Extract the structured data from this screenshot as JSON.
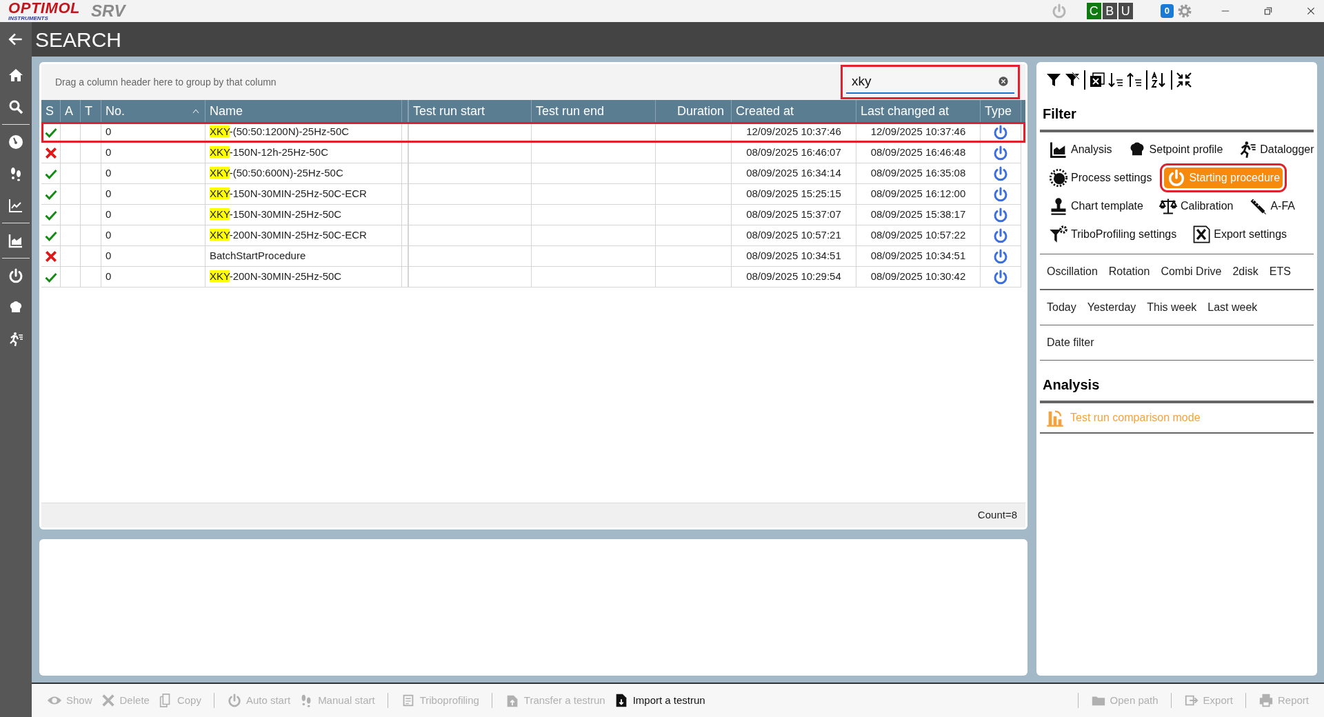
{
  "app_bar": {
    "logo": "OPTIMOL",
    "logo_sub": "INSTRUMENTS",
    "product": "SRV",
    "badges": [
      {
        "label": "C",
        "color": "#0f7a0f"
      },
      {
        "label": "B",
        "color": "#4a4a4a"
      },
      {
        "label": "U",
        "color": "#4a4a4a"
      }
    ],
    "notifications": "0"
  },
  "page": {
    "title": "SEARCH"
  },
  "grid": {
    "group_hint": "Drag a column header here to group by that column",
    "search": {
      "value": "xky",
      "marked": true
    },
    "columns": [
      "S",
      "A",
      "T",
      "No.",
      "Name",
      "Test run start",
      "Test run end",
      "Duration",
      "Created at",
      "Last changed at",
      "Type"
    ],
    "rows": [
      {
        "passed": true,
        "no": "0",
        "match": "XKY",
        "rest": "-(50:50:1200N)-25Hz-50C",
        "created": "12/09/2025 10:37:46",
        "changed": "12/09/2025 10:37:46",
        "marked": true
      },
      {
        "passed": false,
        "no": "0",
        "match": "XKY",
        "rest": "-150N-12h-25Hz-50C",
        "created": "08/09/2025 16:46:07",
        "changed": "08/09/2025 16:46:48",
        "marked": false
      },
      {
        "passed": true,
        "no": "0",
        "match": "XKY",
        "rest": "-(50:50:600N)-25Hz-50C",
        "created": "08/09/2025 16:34:14",
        "changed": "08/09/2025 16:35:08",
        "marked": false
      },
      {
        "passed": true,
        "no": "0",
        "match": "XKY",
        "rest": "-150N-30MIN-25Hz-50C-ECR",
        "created": "08/09/2025 15:25:15",
        "changed": "08/09/2025 16:12:00",
        "marked": false
      },
      {
        "passed": true,
        "no": "0",
        "match": "XKY",
        "rest": "-150N-30MIN-25Hz-50C",
        "created": "08/09/2025 15:37:07",
        "changed": "08/09/2025 15:38:17",
        "marked": false
      },
      {
        "passed": true,
        "no": "0",
        "match": "XKY",
        "rest": "-200N-30MIN-25Hz-50C-ECR",
        "created": "08/09/2025 10:57:21",
        "changed": "08/09/2025 10:57:22",
        "marked": false
      },
      {
        "passed": false,
        "no": "0",
        "rest": "BatchStartProcedure",
        "created": "08/09/2025 10:34:51",
        "changed": "08/09/2025 10:34:51",
        "marked": false
      },
      {
        "passed": true,
        "no": "0",
        "match": "XKY",
        "rest": "-200N-30MIN-25Hz-50C",
        "created": "08/09/2025 10:29:54",
        "changed": "08/09/2025 10:30:42",
        "marked": false
      }
    ],
    "count": "Count=8"
  },
  "filter": {
    "title": "Filter",
    "categories": [
      [
        {
          "label": "Analysis",
          "selected": false,
          "marked": false
        },
        {
          "label": "Setpoint profile",
          "selected": false,
          "marked": false
        },
        {
          "label": "Datalogger",
          "selected": false,
          "marked": false
        }
      ],
      [
        {
          "label": "Process settings",
          "selected": false,
          "marked": false
        },
        {
          "label": "Starting procedure",
          "selected": true,
          "marked": true
        }
      ],
      [
        {
          "label": "Chart template",
          "selected": false,
          "marked": false
        },
        {
          "label": "Calibration",
          "selected": false,
          "marked": false
        },
        {
          "label": "A-FA",
          "selected": false,
          "marked": false
        }
      ],
      [
        {
          "label": "TriboProfiling settings",
          "selected": false,
          "marked": false
        },
        {
          "label": "Export settings",
          "selected": false,
          "marked": false
        }
      ]
    ],
    "modes": [
      {
        "label": "Oscillation",
        "selected": false
      },
      {
        "label": "Rotation",
        "selected": false
      },
      {
        "label": "Combi Drive",
        "selected": false
      },
      {
        "label": "2disk",
        "selected": false
      },
      {
        "label": "ETS",
        "selected": false
      }
    ],
    "dates": [
      {
        "label": "Today",
        "selected": false
      },
      {
        "label": "Yesterday",
        "selected": false
      },
      {
        "label": "This week",
        "selected": false
      },
      {
        "label": "Last week",
        "selected": false
      }
    ],
    "date_filter": "Date filter"
  },
  "analysis": {
    "title": "Analysis",
    "action": "Test run comparison mode"
  },
  "toolbar": {
    "left": [
      [
        {
          "label": "Show",
          "disabled": true
        },
        {
          "label": "Delete",
          "disabled": true
        },
        {
          "label": "Copy",
          "disabled": true
        }
      ],
      [
        {
          "label": "Auto start",
          "disabled": true
        },
        {
          "label": "Manual start",
          "disabled": true
        }
      ],
      [
        {
          "label": "Triboprofiling",
          "disabled": true
        }
      ],
      [
        {
          "label": "Transfer a testrun",
          "disabled": true
        },
        {
          "label": "Import a testrun",
          "disabled": false
        }
      ]
    ],
    "right": [
      [
        {
          "label": "Open path",
          "disabled": true
        }
      ],
      [
        {
          "label": "Export",
          "disabled": true
        }
      ],
      [
        {
          "label": "Report",
          "disabled": true
        }
      ]
    ]
  }
}
